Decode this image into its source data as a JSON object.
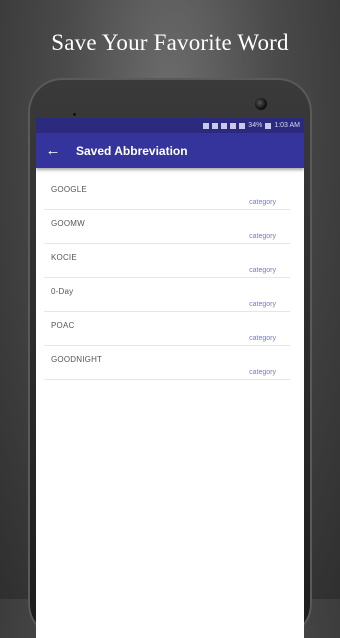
{
  "promo": {
    "headline": "Save Your Favorite Word"
  },
  "statusbar": {
    "battery": "34%",
    "time": "1:03 AM"
  },
  "appbar": {
    "title": "Saved Abbreviation",
    "back_icon": "arrow-left-icon"
  },
  "list": {
    "items": [
      {
        "name": "GOOGLE",
        "category": "category"
      },
      {
        "name": "GOOMW",
        "category": "category"
      },
      {
        "name": "KOCIE",
        "category": "category"
      },
      {
        "name": "0-Day",
        "category": "category"
      },
      {
        "name": "POAC",
        "category": "category"
      },
      {
        "name": "GOODNIGHT",
        "category": "category"
      }
    ]
  },
  "colors": {
    "statusbar": "#2b2a7e",
    "appbar": "#34349c",
    "category_text": "#7b7bb5"
  }
}
